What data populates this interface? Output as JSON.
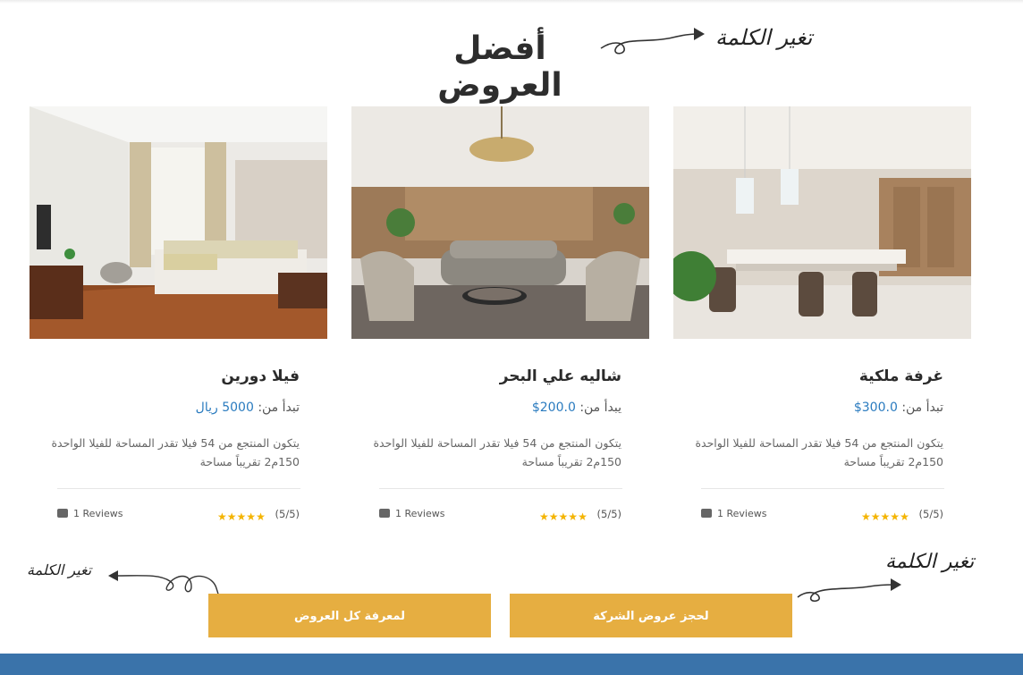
{
  "section": {
    "title": "أفضل العروض",
    "notes": [
      "تغير الكلمة",
      "تغير الكلمة",
      "تغير الكلمة"
    ]
  },
  "cards": [
    {
      "title": "فيلا دورين",
      "price_label": "تبدأ من:",
      "price": "5000 ريال",
      "description": "يتكون المنتجع من 54 فيلا تقدر المساحة للفيلا الواحدة 150م2 تقريباً مساحة",
      "rating": "(5/5)",
      "reviews": "1 Reviews",
      "image": "bedroom"
    },
    {
      "title": "شاليه علي البحر",
      "price_label": "يبدأ من:",
      "price": "200.0$",
      "description": "يتكون المنتجع من 54 فيلا تقدر المساحة للفيلا الواحدة 150م2 تقريباً مساحة",
      "rating": "(5/5)",
      "reviews": "1 Reviews",
      "image": "living-room"
    },
    {
      "title": "غرفة ملكية",
      "price_label": "تبدأ من:",
      "price": "300.0$",
      "description": "يتكون المنتجع من 54 فيلا تقدر المساحة للفيلا الواحدة 150م2 تقريباً مساحة",
      "rating": "(5/5)",
      "reviews": "1 Reviews",
      "image": "dining-room"
    }
  ],
  "buttons": {
    "all_offers": "لمعرفة كل العروض",
    "book_offers": "لحجز عروض الشركة"
  },
  "colors": {
    "accent": "#e6ae41",
    "price": "#2a7bbf",
    "footer": "#3a73aa",
    "star": "#f4b400"
  }
}
